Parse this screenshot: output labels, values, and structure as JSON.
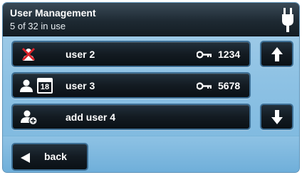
{
  "header": {
    "title": "User Management",
    "subtitle": "5 of 32 in use",
    "icon": "power-plug-icon"
  },
  "user_list": [
    {
      "label": "user 2",
      "icon": "user-disabled-icon",
      "pin": "1234",
      "pin_icon": "key-icon"
    },
    {
      "label": "user 3",
      "icon": "user-calendar-icon",
      "calendar_day": "18",
      "pin": "5678",
      "pin_icon": "key-icon"
    },
    {
      "label": "add user 4",
      "icon": "add-user-icon"
    }
  ],
  "scroll": {
    "up_icon": "arrow-up-icon",
    "down_icon": "arrow-down-icon"
  },
  "footer": {
    "back_label": "back",
    "back_icon": "arrow-left-icon"
  },
  "colors": {
    "background": "#8ec2e4",
    "header_bg": "#1e2a33",
    "button_bg": "#131b22",
    "button_border": "#3d6f95",
    "disabled_red": "#d9232a"
  }
}
